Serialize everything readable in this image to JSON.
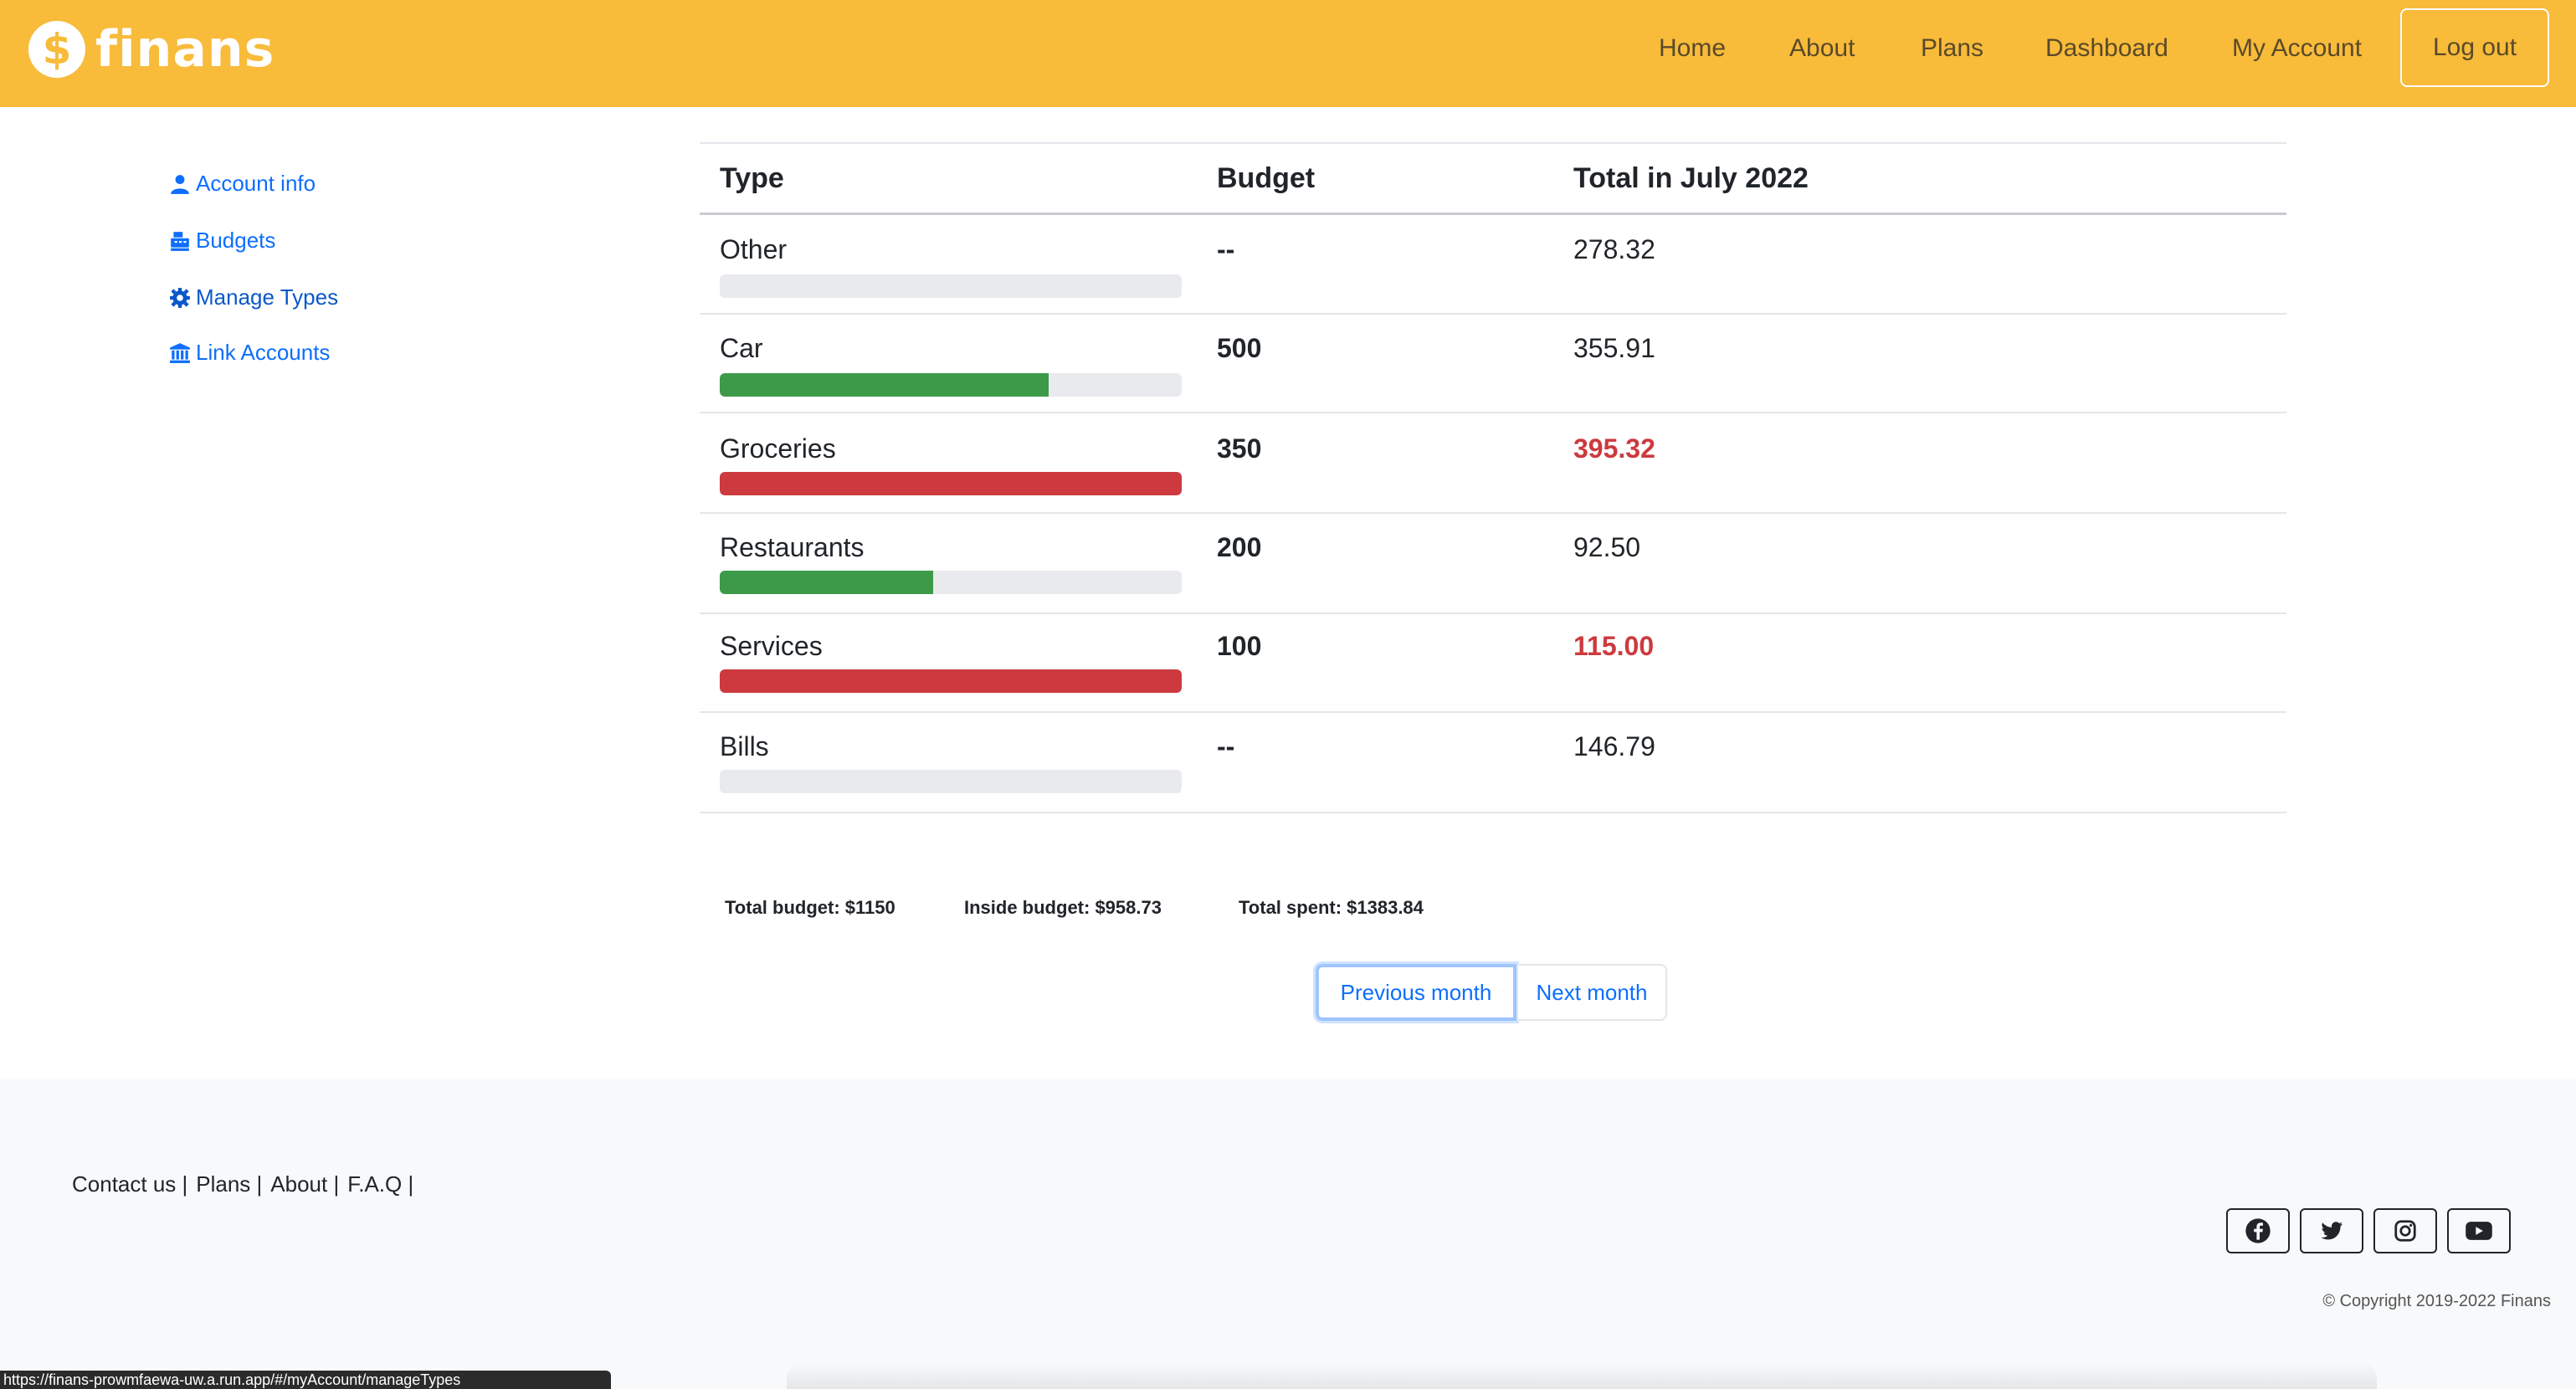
{
  "app": {
    "brand_name": "finans",
    "brand_symbol": "$"
  },
  "nav": {
    "items": [
      "Home",
      "About",
      "Plans",
      "Dashboard",
      "My Account"
    ],
    "logout_label": "Log out"
  },
  "sidebar": {
    "items": [
      {
        "label": "Account info",
        "icon": "user-icon"
      },
      {
        "label": "Budgets",
        "icon": "cash-register-icon"
      },
      {
        "label": "Manage Types",
        "icon": "gear-icon"
      },
      {
        "label": "Link Accounts",
        "icon": "bank-icon"
      }
    ]
  },
  "table": {
    "headers": {
      "type": "Type",
      "budget": "Budget",
      "total": "Total in July 2022"
    },
    "rows": [
      {
        "type": "Other",
        "budget": "--",
        "total": "278.32",
        "over": false,
        "progress": 0
      },
      {
        "type": "Car",
        "budget": "500",
        "total": "355.91",
        "over": false,
        "progress": 0.7118
      },
      {
        "type": "Groceries",
        "budget": "350",
        "total": "395.32",
        "over": true,
        "progress": 1
      },
      {
        "type": "Restaurants",
        "budget": "200",
        "total": "92.50",
        "over": false,
        "progress": 0.4625
      },
      {
        "type": "Services",
        "budget": "100",
        "total": "115.00",
        "over": true,
        "progress": 1
      },
      {
        "type": "Bills",
        "budget": "--",
        "total": "146.79",
        "over": false,
        "progress": 0
      }
    ]
  },
  "summary": {
    "total_budget": "Total budget: $1150",
    "inside_budget": "Inside budget: $958.73",
    "total_spent": "Total spent: $1383.84"
  },
  "pagination": {
    "prev_label": "Previous month",
    "next_label": "Next month"
  },
  "footer": {
    "links": [
      "Contact us |",
      "Plans |",
      "About |",
      "F.A.Q |"
    ],
    "social": [
      "facebook-icon",
      "twitter-icon",
      "instagram-icon",
      "youtube-icon"
    ],
    "copyright": "© Copyright 2019-2022 Finans"
  },
  "status_bar": {
    "url": "https://finans-prowmfaewa-uw.a.run.app/#/myAccount/manageTypes"
  },
  "colors": {
    "brand": "#f8bb3a",
    "ok": "#3d9a49",
    "over": "#cc3a3f",
    "link": "#0d6efd"
  }
}
